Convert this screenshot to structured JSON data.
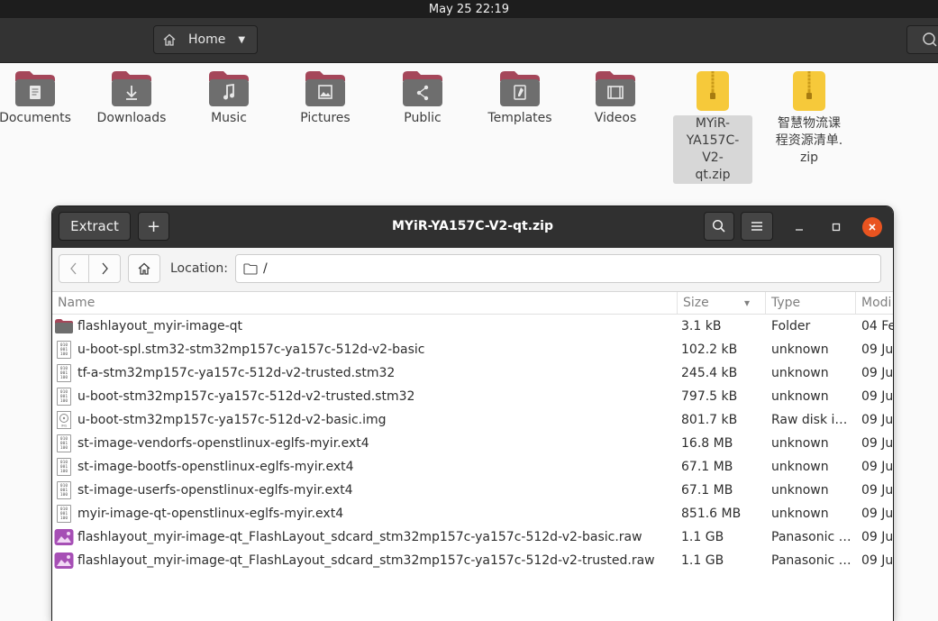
{
  "topbar": {
    "datetime": "May 25  22:19"
  },
  "filemanager": {
    "location_label": "Home"
  },
  "desktop": {
    "items": [
      {
        "label": "Documents",
        "icon": "documents-folder-icon"
      },
      {
        "label": "Downloads",
        "icon": "downloads-folder-icon"
      },
      {
        "label": "Music",
        "icon": "music-folder-icon"
      },
      {
        "label": "Pictures",
        "icon": "pictures-folder-icon"
      },
      {
        "label": "Public",
        "icon": "public-folder-icon"
      },
      {
        "label": "Templates",
        "icon": "templates-folder-icon"
      },
      {
        "label": "Videos",
        "icon": "videos-folder-icon"
      },
      {
        "label": "MYiR-YA157C-V2-qt.zip",
        "label_lines": [
          "MYiR-",
          "YA157C-V2-",
          "qt.zip"
        ],
        "icon": "zip-archive-icon",
        "selected": true
      },
      {
        "label": "智慧物流课程资源清单.zip",
        "label_lines": [
          "智慧物流课",
          "程资源清单.",
          "zip"
        ],
        "icon": "zip-archive-icon"
      }
    ]
  },
  "archive_window": {
    "title": "MYiR-YA157C-V2-qt.zip",
    "extract_label": "Extract",
    "add_label": "+",
    "location_label": "Location:",
    "location_value": "/",
    "columns": [
      "Name",
      "Size",
      "Type",
      "Modi"
    ],
    "sort_indicator": "▾",
    "rows": [
      {
        "name": "flashlayout_myir-image-qt",
        "size": "3.1 kB",
        "type": "Folder",
        "modified": "04 Fe",
        "icon": "folder-icon"
      },
      {
        "name": "u-boot-spl.stm32-stm32mp157c-ya157c-512d-v2-basic",
        "size": "102.2 kB",
        "type": "unknown",
        "modified": "09 Ju",
        "icon": "binary-file-icon"
      },
      {
        "name": "tf-a-stm32mp157c-ya157c-512d-v2-trusted.stm32",
        "size": "245.4 kB",
        "type": "unknown",
        "modified": "09 Ju",
        "icon": "binary-file-icon"
      },
      {
        "name": "u-boot-stm32mp157c-ya157c-512d-v2-trusted.stm32",
        "size": "797.5 kB",
        "type": "unknown",
        "modified": "09 Ju",
        "icon": "binary-file-icon"
      },
      {
        "name": "u-boot-stm32mp157c-ya157c-512d-v2-basic.img",
        "size": "801.7 kB",
        "type": "Raw disk i…",
        "modified": "09 Ju",
        "icon": "disk-image-icon"
      },
      {
        "name": "st-image-vendorfs-openstlinux-eglfs-myir.ext4",
        "size": "16.8 MB",
        "type": "unknown",
        "modified": "09 Ju",
        "icon": "binary-file-icon"
      },
      {
        "name": "st-image-bootfs-openstlinux-eglfs-myir.ext4",
        "size": "67.1 MB",
        "type": "unknown",
        "modified": "09 Ju",
        "icon": "binary-file-icon"
      },
      {
        "name": "st-image-userfs-openstlinux-eglfs-myir.ext4",
        "size": "67.1 MB",
        "type": "unknown",
        "modified": "09 Ju",
        "icon": "binary-file-icon"
      },
      {
        "name": "myir-image-qt-openstlinux-eglfs-myir.ext4",
        "size": "851.6 MB",
        "type": "unknown",
        "modified": "09 Ju",
        "icon": "binary-file-icon"
      },
      {
        "name": "flashlayout_myir-image-qt_FlashLayout_sdcard_stm32mp157c-ya157c-512d-v2-basic.raw",
        "size": "1.1 GB",
        "type": "Panasonic r…",
        "modified": "09 Ju",
        "icon": "raw-image-icon"
      },
      {
        "name": "flashlayout_myir-image-qt_FlashLayout_sdcard_stm32mp157c-ya157c-512d-v2-trusted.raw",
        "size": "1.1 GB",
        "type": "Panasonic r…",
        "modified": "09 Ju",
        "icon": "raw-image-icon"
      }
    ]
  },
  "colors": {
    "accent": "#e95420",
    "folder": "#6e6e6e",
    "folder_tab": "#a5475a",
    "zip": "#f6c93a",
    "raw_image": "#a64fb5"
  }
}
